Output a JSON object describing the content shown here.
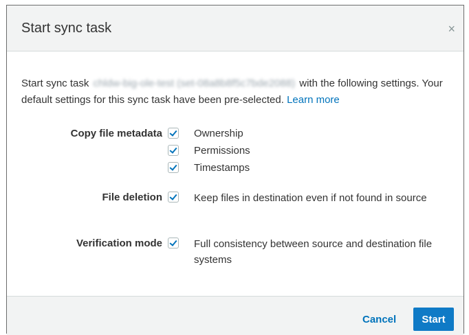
{
  "dialog": {
    "title": "Start sync task",
    "close_glyph": "×"
  },
  "intro": {
    "prefix": "Start sync task",
    "task_name_blurred": "chldw-big-ole-test (set-08a8b8f5c7bde2088)",
    "middle": "with the following settings. Your default settings for this sync task have been pre-selected.",
    "learn_more": "Learn more"
  },
  "settings": {
    "copy_metadata": {
      "label": "Copy file metadata",
      "options": [
        {
          "text": "Ownership",
          "checked": true
        },
        {
          "text": "Permissions",
          "checked": true
        },
        {
          "text": "Timestamps",
          "checked": true
        }
      ]
    },
    "file_deletion": {
      "label": "File deletion",
      "option": {
        "text": "Keep files in destination even if not found in source",
        "checked": true
      }
    },
    "verification_mode": {
      "label": "Verification mode",
      "option": {
        "text": "Full consistency between source and destination file systems",
        "checked": true
      }
    }
  },
  "footer": {
    "cancel_label": "Cancel",
    "start_label": "Start"
  },
  "colors": {
    "accent": "#0073bb",
    "primary_button": "#0f7ac6",
    "header_bg": "#f2f3f3"
  },
  "icons": [
    "close-icon",
    "checkbox-checked-icon"
  ]
}
